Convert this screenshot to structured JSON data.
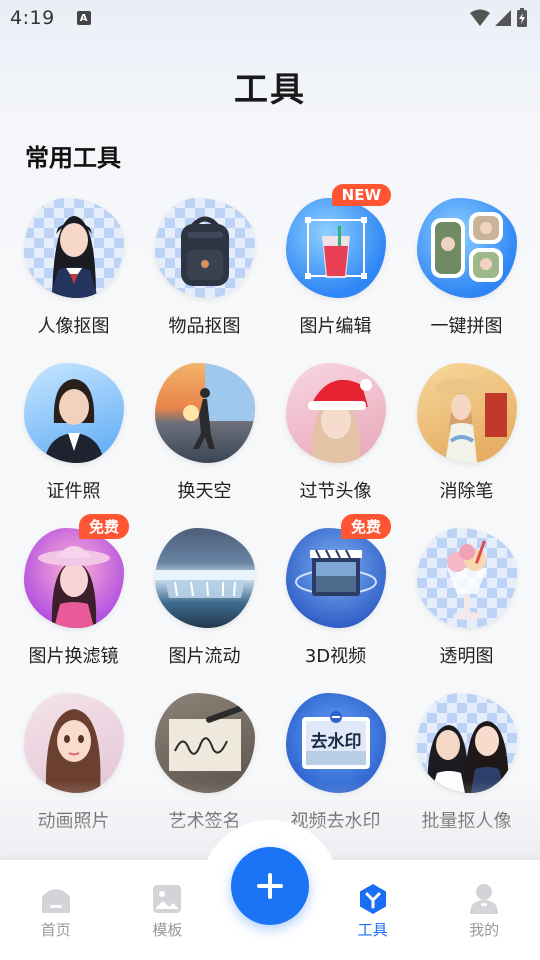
{
  "status": {
    "time": "4:19",
    "indicator": "A"
  },
  "page": {
    "title": "工具"
  },
  "section": {
    "title": "常用工具"
  },
  "tools": [
    {
      "label": "人像抠图",
      "icon": "portrait-cutout-icon",
      "badge": ""
    },
    {
      "label": "物品抠图",
      "icon": "object-cutout-icon",
      "badge": ""
    },
    {
      "label": "图片编辑",
      "icon": "image-edit-icon",
      "badge": "NEW"
    },
    {
      "label": "一键拼图",
      "icon": "collage-icon",
      "badge": ""
    },
    {
      "label": "证件照",
      "icon": "id-photo-icon",
      "badge": ""
    },
    {
      "label": "换天空",
      "icon": "sky-replace-icon",
      "badge": ""
    },
    {
      "label": "过节头像",
      "icon": "holiday-avatar-icon",
      "badge": ""
    },
    {
      "label": "消除笔",
      "icon": "eraser-pen-icon",
      "badge": ""
    },
    {
      "label": "图片换滤镜",
      "icon": "filter-icon",
      "badge": "免费"
    },
    {
      "label": "图片流动",
      "icon": "image-flow-icon",
      "badge": ""
    },
    {
      "label": "3D视频",
      "icon": "3d-video-icon",
      "badge": "免费"
    },
    {
      "label": "透明图",
      "icon": "transparent-image-icon",
      "badge": ""
    },
    {
      "label": "动画照片",
      "icon": "animated-photo-icon",
      "badge": ""
    },
    {
      "label": "艺术签名",
      "icon": "art-signature-icon",
      "badge": ""
    },
    {
      "label": "视频去水印",
      "icon": "video-watermark-remove-icon",
      "badge": "",
      "icon_text": "去水印"
    },
    {
      "label": "批量抠人像",
      "icon": "batch-portrait-cutout-icon",
      "badge": ""
    }
  ],
  "tabbar": {
    "items": [
      {
        "label": "首页",
        "icon": "home-icon",
        "active": false
      },
      {
        "label": "模板",
        "icon": "template-icon",
        "active": false
      },
      {
        "label": "工具",
        "icon": "tools-icon",
        "active": true
      },
      {
        "label": "我的",
        "icon": "profile-icon",
        "active": false
      }
    ],
    "fab_icon": "plus-icon",
    "active_color": "#1a6ef5",
    "inactive_color": "#999999"
  },
  "colors": {
    "accent": "#1a74f5",
    "badge": "#ff5533"
  }
}
